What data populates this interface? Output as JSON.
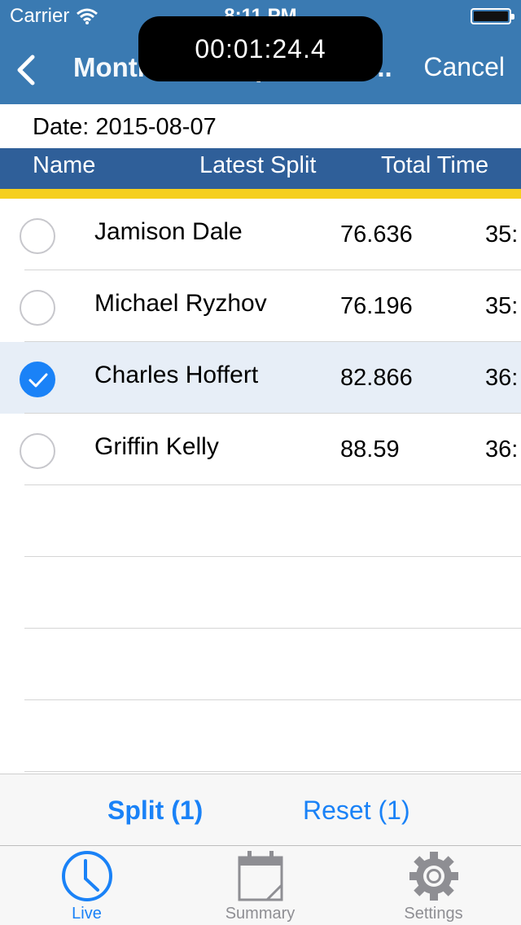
{
  "status_bar": {
    "carrier": "Carrier",
    "time": "8:11 PM"
  },
  "timer": "00:01:24.4",
  "nav": {
    "title": "Montrose Tempo Full R...",
    "cancel_label": "Cancel"
  },
  "date": "Date: 2015-08-07",
  "columns": {
    "name": "Name",
    "latest_split": "Latest Split",
    "total_time": "Total Time"
  },
  "athletes": [
    {
      "name": "Jamison Dale",
      "latest_split": "76.636",
      "total_time": "35:",
      "selected": false
    },
    {
      "name": "Michael Ryzhov",
      "latest_split": "76.196",
      "total_time": "35:",
      "selected": false
    },
    {
      "name": "Charles Hoffert",
      "latest_split": "82.866",
      "total_time": "36:",
      "selected": true
    },
    {
      "name": "Griffin Kelly",
      "latest_split": "88.59",
      "total_time": "36:",
      "selected": false
    }
  ],
  "actions": {
    "split_label": "Split (1)",
    "reset_label": "Reset (1)"
  },
  "tabs": [
    {
      "label": "Live",
      "icon": "clock-icon",
      "active": true
    },
    {
      "label": "Summary",
      "icon": "calendar-icon",
      "active": false
    },
    {
      "label": "Settings",
      "icon": "gear-icon",
      "active": false
    }
  ],
  "colors": {
    "nav_bar": "#3a7ab2",
    "header_bar": "#2f5f99",
    "accent": "#1a82f7",
    "stripe": "#f5cf1e"
  }
}
